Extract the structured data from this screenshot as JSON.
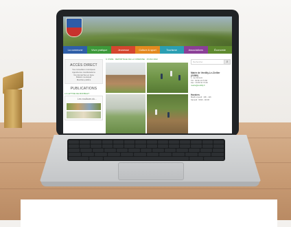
{
  "colors": {
    "nav": [
      "#2f5fa8",
      "#3d9a3b",
      "#d5462f",
      "#e48a1f",
      "#2b9fb3",
      "#8b3f97",
      "#5f8a2f"
    ]
  },
  "website": {
    "logo": "shield-icon",
    "nav": [
      "La commune",
      "Vivre pratique",
      "Jeunesse",
      "Culture & sport",
      "Tourisme",
      "Associations",
      "Économie"
    ],
    "sidebar": {
      "acces_title": "ACCÈS DIRECT",
      "acces_links": [
        "Vos conseillers municipaux",
        "Agenda des manifestations",
        "Vos démarches en ligne",
        "Bulletin municipal",
        "Marchés publics"
      ],
      "publications_title": "PUBLICATIONS",
      "publications_sub": "LA LETTRE DE MONBLET",
      "leaflet_title": "Les coulisses du..."
    },
    "breadcrumb": "À VIVRE · REPORTAGE DE LA COMMUNE · 15 MAI 2022",
    "right": {
      "search_placeholder": "Rechercher",
      "title_lines": [
        "Mairie de Verdilly-Le-Ciellier",
        "(21580)"
      ],
      "info_lines": [
        "1, rue Dumont",
        "Tél : 03 80 10 73 68",
        "Fax : 03 80 10 73 69"
      ],
      "email": "mairie@verdilly.fr",
      "horaires_title": "Horaires",
      "horaires_lines": [
        "Mardi et jeudi : 10h - 12h",
        "Samedi : 9h30 - 11h30"
      ]
    }
  }
}
